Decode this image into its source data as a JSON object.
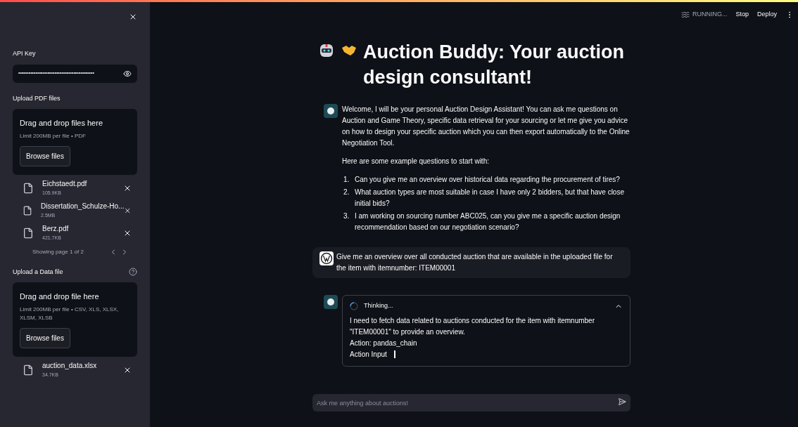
{
  "sidebar": {
    "api_key": {
      "label": "API Key",
      "value": "••••••••••••••••••••••••••••••••••••••••••••"
    },
    "pdf_upload": {
      "label": "Upload PDF files",
      "drop_title": "Drag and drop files here",
      "limit": "Limit 200MB per file • PDF",
      "button": "Browse files",
      "files": [
        {
          "name": "Eichstaedt.pdf",
          "size": "105.9KB"
        },
        {
          "name": "Dissertation_Schulze-Ho...",
          "size": "2.5MB"
        },
        {
          "name": "Berz.pdf",
          "size": "421.7KB"
        }
      ],
      "pagination": "Showing page 1 of 2"
    },
    "data_upload": {
      "label": "Upload a Data file",
      "drop_title": "Drag and drop file here",
      "limit": "Limit 200MB per file • CSV, XLS, XLSX, XLSM, XLSB",
      "button": "Browse files",
      "files": [
        {
          "name": "auction_data.xlsx",
          "size": "34.7KB"
        }
      ]
    }
  },
  "toolbar": {
    "status": "RUNNING...",
    "buttons": [
      "Stop",
      "Deploy"
    ]
  },
  "title": "Auction Buddy: Your auction design consultant!",
  "messages": [
    {
      "kind": "assistant",
      "paragraphs": [
        "Welcome, I will be your personal Auction Design Assistant! You can ask me questions on Auction and Game Theory, specific data retrieval for your sourcing or let me give you advice on how to design your specific auction which you can then export automatically to the Online Negotiation Tool.",
        "Here are some example questions to start with:"
      ],
      "list": [
        {
          "number": "1.",
          "text": "Can you give me an overview over historical data regarding the procurement of tires?"
        },
        {
          "number": "2.",
          "text": "What auction types are most suitable in case I have only 2 bidders, but that have close initial bids?"
        },
        {
          "number": "3.",
          "text": "I am working on sourcing number ABC025, can you give me a specific auction design recommendation based on our negotiation scenario?"
        }
      ]
    },
    {
      "kind": "user",
      "paragraphs": [
        "Give me an overview over all conducted auction that are available in the uploaded file for the item with itemnumber: ITEM00001"
      ]
    },
    {
      "kind": "thinking",
      "status": "Thinking...",
      "expanded": true,
      "lines": [
        "I need to fetch data related to auctions conducted for the item with itemnumber \"ITEM00001\" to provide an overview.",
        "Action: pandas_chain",
        "Action Input"
      ]
    }
  ],
  "chat_input": {
    "placeholder": "Ask me anything about auctions!"
  }
}
